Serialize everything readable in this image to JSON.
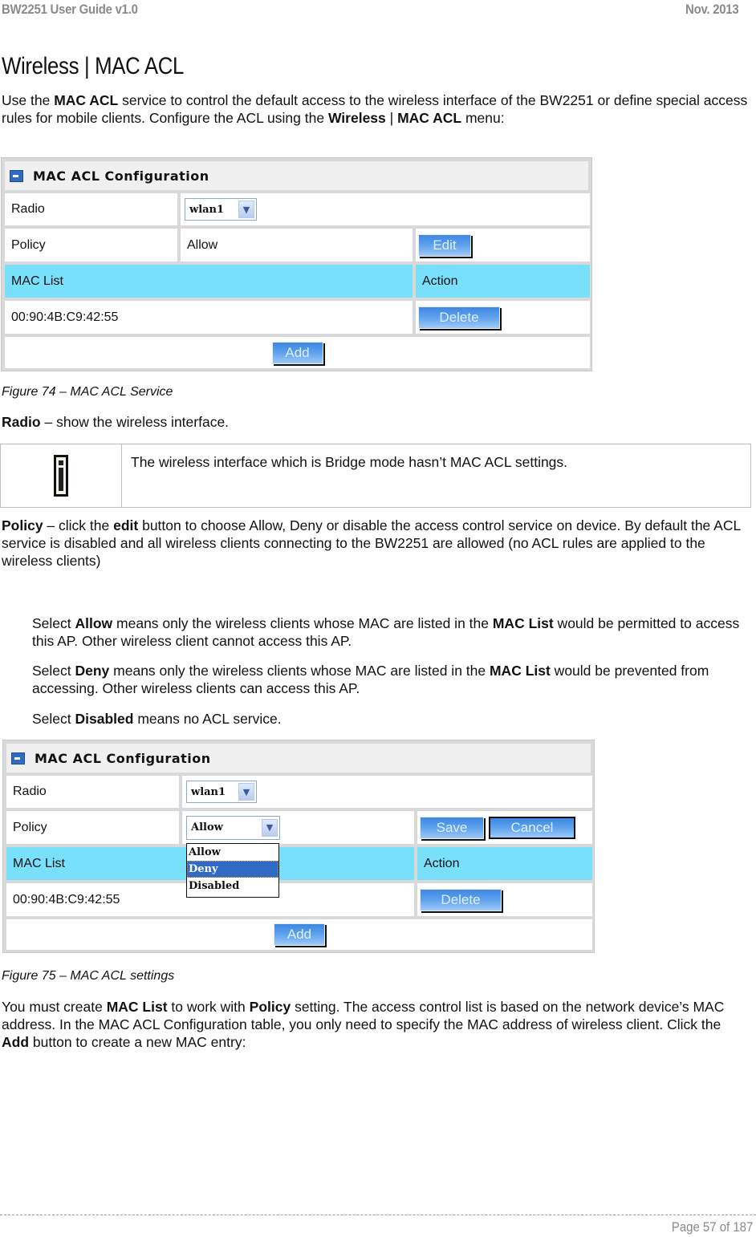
{
  "header": {
    "doc_title": "BW2251 User Guide v1.0",
    "date": "Nov.  2013"
  },
  "section_title": "Wireless | MAC ACL",
  "intro": {
    "t1": "Use the ",
    "b1": "MAC ACL",
    "t2": " service to control the default access to the wireless interface of the BW2251 or define special access rules for mobile clients. Configure the ACL using the ",
    "b2": "Wireless",
    "t3": " | ",
    "b3": "MAC ACL",
    "t4": " menu:"
  },
  "figure1": {
    "panel_title": "MAC ACL Configuration",
    "radio_label": "Radio",
    "radio_value": "wlan1",
    "policy_label": "Policy",
    "policy_value": "Allow",
    "edit_button": "Edit",
    "mac_list_header": "MAC List",
    "action_header": "Action",
    "mac_entries": [
      {
        "mac": "00:90:4B:C9:42:55",
        "action": "Delete"
      }
    ],
    "add_button": "Add",
    "caption": "Figure 74 – MAC ACL Service"
  },
  "radio_desc": {
    "b": "Radio",
    "t": " – show the wireless interface."
  },
  "note": {
    "icon": "info-icon",
    "text": "The wireless interface which is Bridge mode hasn’t MAC ACL settings."
  },
  "policy_desc": {
    "b1": "Policy",
    "t1": " – click the ",
    "b2": "edit",
    "t2": " button to choose Allow, Deny or disable the access control service on device. By default the ACL service is disabled and all wireless clients connecting to the BW2251 are allowed (no ACL rules are applied to the wireless clients)"
  },
  "options_desc": [
    {
      "t1": "Select ",
      "b": "Allow",
      "t2": " means only the wireless clients whose MAC are listed in the ",
      "b2": "MAC List",
      "t3": " would be permitted to access this AP. Other wireless client cannot access this AP."
    },
    {
      "t1": "Select ",
      "b": "Deny",
      "t2": " means only the wireless clients whose MAC are listed in the ",
      "b2": "MAC List",
      "t3": " would be prevented from accessing. Other wireless clients can access this AP."
    },
    {
      "t1": "Select ",
      "b": "Disabled",
      "t2": " means no ACL service.",
      "b2": "",
      "t3": ""
    }
  ],
  "figure2": {
    "panel_title": "MAC ACL Configuration",
    "radio_label": "Radio",
    "radio_value": "wlan1",
    "policy_label": "Policy",
    "policy_value": "Allow",
    "policy_options": [
      "Allow",
      "Deny",
      "Disabled"
    ],
    "policy_highlighted": "Deny",
    "save_button": "Save",
    "cancel_button": "Cancel",
    "mac_list_header": "MAC List",
    "action_header": "Action",
    "mac_entries": [
      {
        "mac": "00:90:4B:C9:42:55",
        "action": "Delete"
      }
    ],
    "add_button": "Add",
    "caption": "Figure 75 – MAC ACL settings"
  },
  "closing": {
    "t1": "You must create ",
    "b1": "MAC List",
    "t2": " to work with ",
    "b2": "Policy",
    "t3": " setting. The access control list is based on the network device’s MAC address. In the MAC ACL Configuration table, you only need to specify the MAC address of wireless client. Click the ",
    "b3": "Add",
    "t4": " button to create a new MAC entry:"
  },
  "footer": {
    "page": "Page 57 of 187"
  }
}
